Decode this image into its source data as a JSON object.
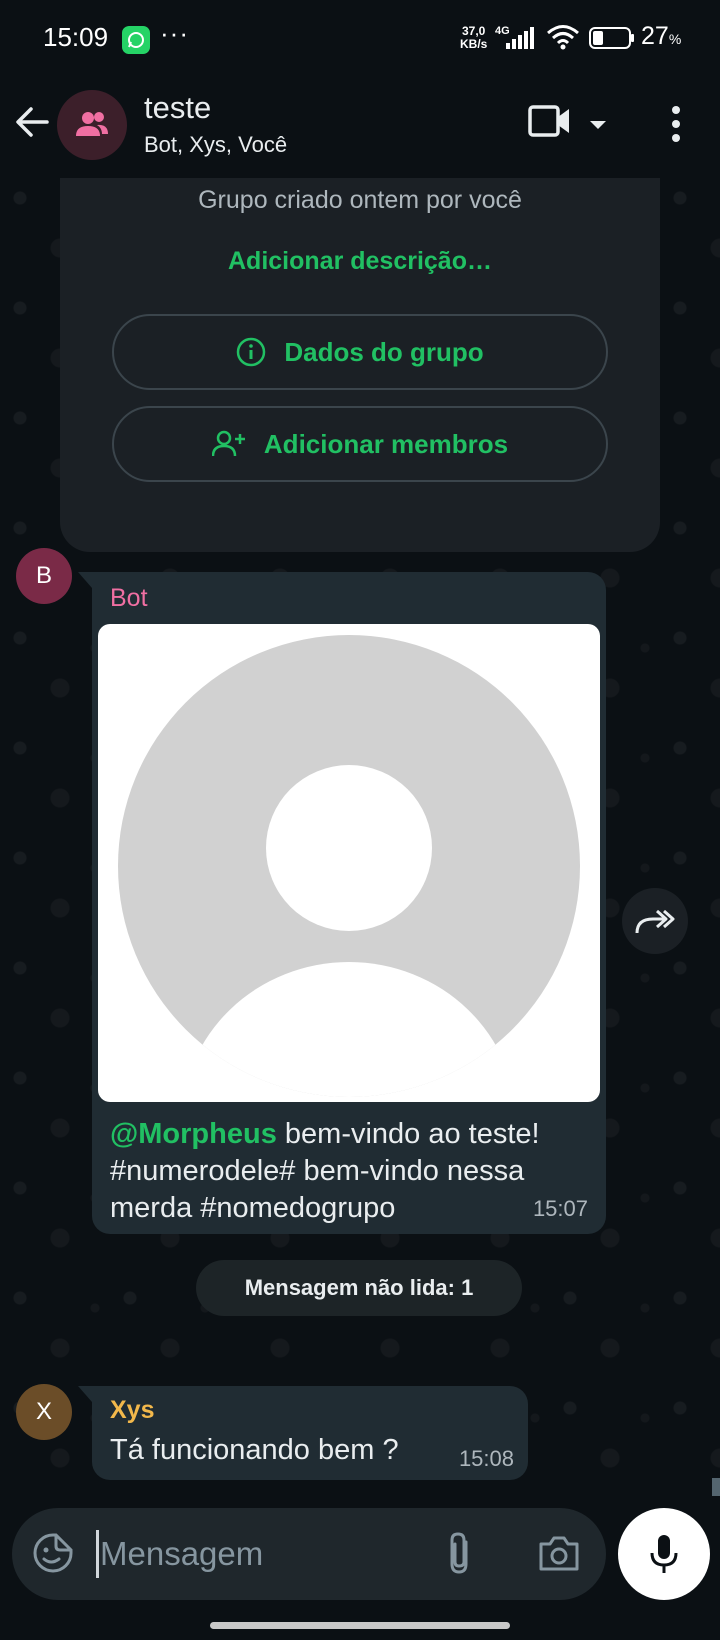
{
  "status_bar": {
    "time": "15:09",
    "dots": "···",
    "net_speed_top": "37,0",
    "net_speed_bottom": "KB/s",
    "net_type": "4G",
    "battery_value": "27",
    "battery_unit": "%",
    "icons": [
      "whatsapp-icon",
      "signal-icon",
      "wifi-icon",
      "battery-icon"
    ]
  },
  "header": {
    "title": "teste",
    "subtitle": "Bot, Xys, Você",
    "icons": [
      "back-arrow-icon",
      "group-icon",
      "video-call-icon",
      "dropdown-arrow-icon",
      "more-options-icon"
    ]
  },
  "system_card": {
    "created_text": "Grupo criado ontem por você",
    "add_description": "Adicionar descrição…",
    "group_data_button": "Dados do grupo",
    "add_members_button": "Adicionar membros"
  },
  "messages": [
    {
      "avatar_letter": "B",
      "sender": "Bot",
      "mention": "@Morpheus",
      "text_after_mention": " bem-vindo ao teste! #numerodele# bem-vindo nessa merda #nomedogrupo",
      "time": "15:07"
    },
    {
      "avatar_letter": "X",
      "sender": "Xys",
      "text": "Tá funcionando bem ?",
      "time": "15:08"
    }
  ],
  "unread_label": "Mensagem não lida: 1",
  "input": {
    "placeholder": "Mensagem",
    "value": ""
  },
  "colors": {
    "background": "#0b1014",
    "bubble": "#202c33",
    "accent_green": "#21c063",
    "bot_name": "#f06fa2",
    "xys_name": "#f2b84b"
  }
}
